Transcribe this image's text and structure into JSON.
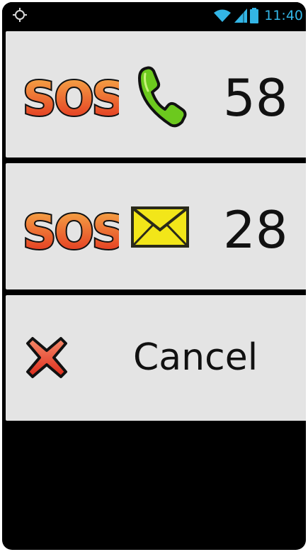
{
  "status_bar": {
    "time": "11:40",
    "icons": [
      "location-icon",
      "wifi-icon",
      "signal-icon",
      "battery-icon"
    ]
  },
  "actions": {
    "sos_call": {
      "label": "SOS",
      "icon": "phone-icon",
      "countdown": "58"
    },
    "sos_sms": {
      "label": "SOS",
      "icon": "envelope-icon",
      "countdown": "28"
    },
    "cancel": {
      "label": "Cancel",
      "icon": "close-icon"
    }
  },
  "colors": {
    "tile_bg": "#e4e4e4",
    "sos_gradient_top": "#f7b14a",
    "sos_gradient_bottom": "#e12a1c",
    "phone_green": "#6cc91e",
    "envelope_yellow": "#f2e619",
    "status_blue": "#33b5e5"
  }
}
